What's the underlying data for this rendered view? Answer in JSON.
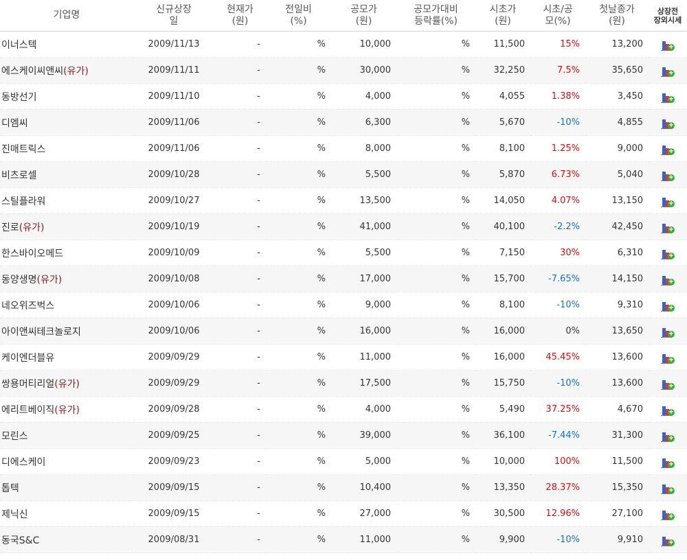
{
  "headers": {
    "company": "기업명",
    "listing_date": [
      "신규상장",
      "일"
    ],
    "current_price": [
      "현재가",
      "(원)"
    ],
    "change": [
      "전일비",
      "(%)"
    ],
    "ipo_price": [
      "공모가",
      "(원)"
    ],
    "vs_ipo": [
      "공모가대비",
      "등락률(%)"
    ],
    "open_price": [
      "시초가",
      "(원)"
    ],
    "open_vs_ipo": [
      "시초/공",
      "모(%)"
    ],
    "first_close": [
      "첫날종가",
      "(원)"
    ],
    "otc_price": [
      "상장전",
      "장외시세"
    ]
  },
  "rows": [
    {
      "name": "이너스텍",
      "tag": "",
      "date": "2009/11/13",
      "current": "-",
      "change": "%",
      "ipo": "10,000",
      "vs_ipo": "%",
      "open": "11,500",
      "open_pct": "15%",
      "dir": "up",
      "first_close": "13,200"
    },
    {
      "name": "에스케이씨앤씨",
      "tag": "(유가)",
      "date": "2009/11/11",
      "current": "-",
      "change": "%",
      "ipo": "30,000",
      "vs_ipo": "%",
      "open": "32,250",
      "open_pct": "7.5%",
      "dir": "up",
      "first_close": "35,650"
    },
    {
      "name": "동방선기",
      "tag": "",
      "date": "2009/11/10",
      "current": "-",
      "change": "%",
      "ipo": "4,000",
      "vs_ipo": "%",
      "open": "4,055",
      "open_pct": "1.38%",
      "dir": "up",
      "first_close": "3,450"
    },
    {
      "name": "디엠씨",
      "tag": "",
      "date": "2009/11/06",
      "current": "-",
      "change": "%",
      "ipo": "6,300",
      "vs_ipo": "%",
      "open": "5,670",
      "open_pct": "-10%",
      "dir": "down",
      "first_close": "4,855"
    },
    {
      "name": "진매트릭스",
      "tag": "",
      "date": "2009/11/06",
      "current": "-",
      "change": "%",
      "ipo": "8,000",
      "vs_ipo": "%",
      "open": "8,100",
      "open_pct": "1.25%",
      "dir": "up",
      "first_close": "9,000"
    },
    {
      "name": "비츠로셀",
      "tag": "",
      "date": "2009/10/28",
      "current": "-",
      "change": "%",
      "ipo": "5,500",
      "vs_ipo": "%",
      "open": "5,870",
      "open_pct": "6.73%",
      "dir": "up",
      "first_close": "5,040"
    },
    {
      "name": "스틸플라워",
      "tag": "",
      "date": "2009/10/27",
      "current": "-",
      "change": "%",
      "ipo": "13,500",
      "vs_ipo": "%",
      "open": "14,050",
      "open_pct": "4.07%",
      "dir": "up",
      "first_close": "13,150"
    },
    {
      "name": "진로",
      "tag": "(유가)",
      "date": "2009/10/19",
      "current": "-",
      "change": "%",
      "ipo": "41,000",
      "vs_ipo": "%",
      "open": "40,100",
      "open_pct": "-2.2%",
      "dir": "down",
      "first_close": "42,450"
    },
    {
      "name": "한스바이오메드",
      "tag": "",
      "date": "2009/10/09",
      "current": "-",
      "change": "%",
      "ipo": "5,500",
      "vs_ipo": "%",
      "open": "7,150",
      "open_pct": "30%",
      "dir": "up",
      "first_close": "6,310"
    },
    {
      "name": "동양생명",
      "tag": "(유가)",
      "date": "2009/10/08",
      "current": "-",
      "change": "%",
      "ipo": "17,000",
      "vs_ipo": "%",
      "open": "15,700",
      "open_pct": "-7.65%",
      "dir": "down",
      "first_close": "14,150"
    },
    {
      "name": "네오위즈벅스",
      "tag": "",
      "date": "2009/10/06",
      "current": "-",
      "change": "%",
      "ipo": "9,000",
      "vs_ipo": "%",
      "open": "8,100",
      "open_pct": "-10%",
      "dir": "down",
      "first_close": "9,310"
    },
    {
      "name": "아이앤씨테크놀로지",
      "tag": "",
      "date": "2009/10/06",
      "current": "-",
      "change": "%",
      "ipo": "16,000",
      "vs_ipo": "%",
      "open": "16,000",
      "open_pct": "0%",
      "dir": "flat",
      "first_close": "13,650"
    },
    {
      "name": "케이엔더블유",
      "tag": "",
      "date": "2009/09/29",
      "current": "-",
      "change": "%",
      "ipo": "11,000",
      "vs_ipo": "%",
      "open": "16,000",
      "open_pct": "45.45%",
      "dir": "up",
      "first_close": "13,600"
    },
    {
      "name": "쌍용머티리얼",
      "tag": "(유가)",
      "date": "2009/09/29",
      "current": "-",
      "change": "%",
      "ipo": "17,500",
      "vs_ipo": "%",
      "open": "15,750",
      "open_pct": "-10%",
      "dir": "down",
      "first_close": "13,600"
    },
    {
      "name": "에리트베이직",
      "tag": "(유가)",
      "date": "2009/09/28",
      "current": "-",
      "change": "%",
      "ipo": "4,000",
      "vs_ipo": "%",
      "open": "5,490",
      "open_pct": "37.25%",
      "dir": "up",
      "first_close": "4,670"
    },
    {
      "name": "모린스",
      "tag": "",
      "date": "2009/09/25",
      "current": "-",
      "change": "%",
      "ipo": "39,000",
      "vs_ipo": "%",
      "open": "36,100",
      "open_pct": "-7.44%",
      "dir": "down",
      "first_close": "31,300"
    },
    {
      "name": "디에스케이",
      "tag": "",
      "date": "2009/09/23",
      "current": "-",
      "change": "%",
      "ipo": "5,000",
      "vs_ipo": "%",
      "open": "10,000",
      "open_pct": "100%",
      "dir": "up",
      "first_close": "11,500"
    },
    {
      "name": "톱텍",
      "tag": "",
      "date": "2009/09/15",
      "current": "-",
      "change": "%",
      "ipo": "10,400",
      "vs_ipo": "%",
      "open": "13,350",
      "open_pct": "28.37%",
      "dir": "up",
      "first_close": "15,350"
    },
    {
      "name": "제닉신",
      "tag": "",
      "date": "2009/09/15",
      "current": "-",
      "change": "%",
      "ipo": "27,000",
      "vs_ipo": "%",
      "open": "30,500",
      "open_pct": "12.96%",
      "dir": "up",
      "first_close": "27,100"
    },
    {
      "name": "동국S&C",
      "tag": "",
      "date": "2009/08/31",
      "current": "-",
      "change": "%",
      "ipo": "11,000",
      "vs_ipo": "%",
      "open": "9,900",
      "open_pct": "-10%",
      "dir": "down",
      "first_close": "9,910"
    }
  ],
  "icon": "otc-chart-icon",
  "colors": {
    "up": "#d01010",
    "down": "#1a6fbf",
    "tag": "#8b1a1a"
  }
}
